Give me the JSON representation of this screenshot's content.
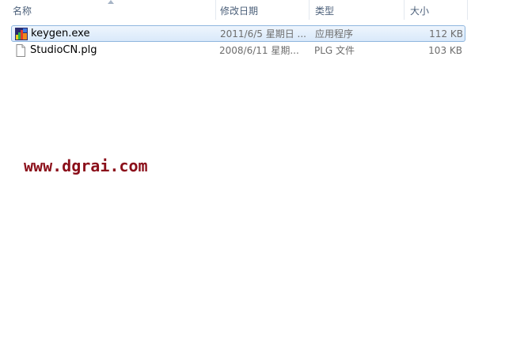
{
  "columns": {
    "name": "名称",
    "date": "修改日期",
    "type": "类型",
    "size": "大小"
  },
  "sort": {
    "column": "name",
    "direction": "ascending",
    "icon": "sort-up-arrow-icon"
  },
  "files": [
    {
      "name": "keygen.exe",
      "date": "2011/6/5 星期日 ...",
      "type": "应用程序",
      "size": "112 KB",
      "icon": "exe-app-icon",
      "selected": true
    },
    {
      "name": "StudioCN.plg",
      "date": "2008/6/11 星期...",
      "type": "PLG 文件",
      "size": "103 KB",
      "icon": "blank-file-icon",
      "selected": false
    }
  ],
  "watermark": "www.dgrai.com",
  "colors": {
    "selection_border": "#8fb6de",
    "selection_fill": "#d9e9fa",
    "header_text": "#4c607a",
    "watermark": "#8b0f1a"
  }
}
